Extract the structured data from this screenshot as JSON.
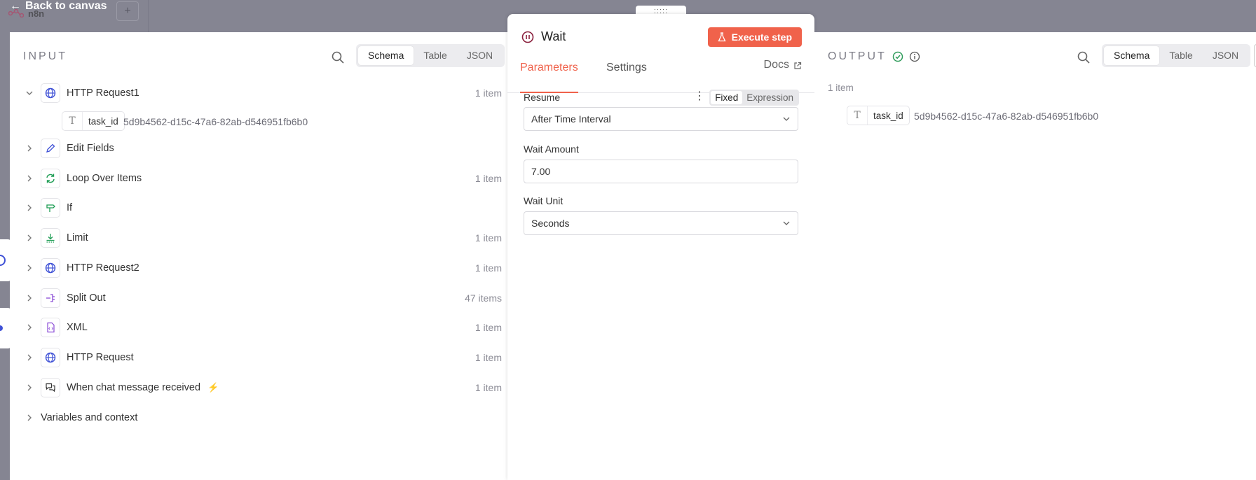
{
  "topbar": {
    "back_label": "Back to canvas",
    "logo_text": "n8n",
    "plus": "+"
  },
  "input": {
    "title": "INPUT",
    "view_options": [
      "Schema",
      "Table",
      "JSON"
    ],
    "active_view": "Schema",
    "nodes": [
      {
        "label": "HTTP Request1",
        "count": "1 item",
        "icon": "globe-icon",
        "expanded": true
      },
      {
        "label": "Edit Fields",
        "count": "",
        "icon": "pencil-icon"
      },
      {
        "label": "Loop Over Items",
        "count": "1 item",
        "icon": "loop-icon"
      },
      {
        "label": "If",
        "count": "",
        "icon": "signpost-icon"
      },
      {
        "label": "Limit",
        "count": "1 item",
        "icon": "limit-icon"
      },
      {
        "label": "HTTP Request2",
        "count": "1 item",
        "icon": "globe-icon"
      },
      {
        "label": "Split Out",
        "count": "47 items",
        "icon": "split-icon"
      },
      {
        "label": "XML",
        "count": "1 item",
        "icon": "xml-file-icon"
      },
      {
        "label": "HTTP Request",
        "count": "1 item",
        "icon": "globe-icon"
      },
      {
        "label": "When chat message received",
        "count": "1 item",
        "icon": "chat-icon",
        "trigger": true
      }
    ],
    "field": {
      "type_icon": "T",
      "name": "task_id",
      "value": "5d9b4562-d15c-47a6-82ab-d546951fb6b0"
    },
    "variables_label": "Variables and context"
  },
  "wait": {
    "title": "Wait",
    "execute_label": "Execute step",
    "drag_handle": ":::::",
    "tabs": [
      "Parameters",
      "Settings"
    ],
    "active_tab": "Parameters",
    "docs_label": "Docs",
    "resume_label": "Resume",
    "mode_options": [
      "Fixed",
      "Expression"
    ],
    "active_mode": "Fixed",
    "resume_value": "After Time Interval",
    "amount_label": "Wait Amount",
    "amount_value": "7.00",
    "unit_label": "Wait Unit",
    "unit_value": "Seconds"
  },
  "output": {
    "title": "OUTPUT",
    "view_options": [
      "Schema",
      "Table",
      "JSON"
    ],
    "active_view": "Schema",
    "item_count": "1 item",
    "field": {
      "type_icon": "T",
      "name": "task_id",
      "value": "5d9b4562-d15c-47a6-82ab-d546951fb6b0"
    }
  },
  "colors": {
    "accent": "#f0624b",
    "success": "#2e9b5a",
    "overlay": "#858592",
    "node_blue": "#3f51d6",
    "node_green": "#1f9d55",
    "node_purple": "#8a4bd6"
  }
}
